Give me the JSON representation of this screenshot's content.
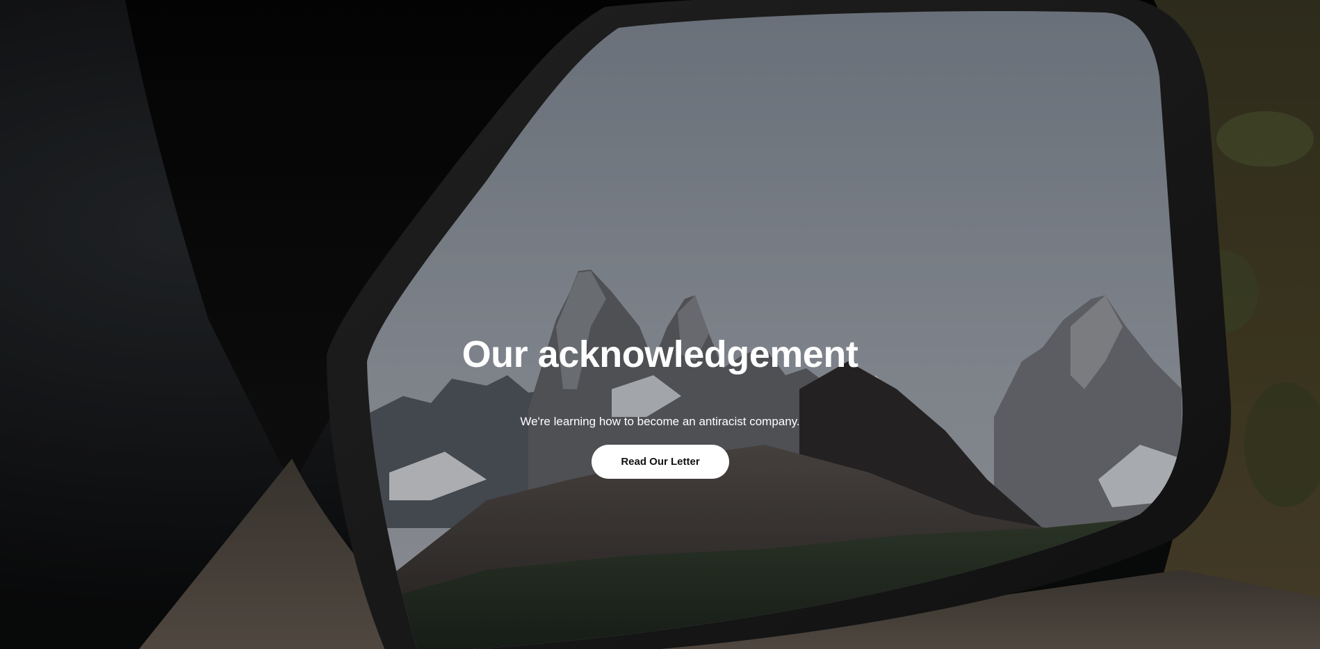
{
  "hero": {
    "title": "Our acknowledgement",
    "subtitle": "We're learning how to become an antiracist company.",
    "cta_label": "Read Our Letter",
    "background_image": "side-mirror-reflecting-snowy-mountain-peaks"
  },
  "colors": {
    "title": "#ffffff",
    "button_bg": "#ffffff",
    "button_text": "#111111"
  }
}
